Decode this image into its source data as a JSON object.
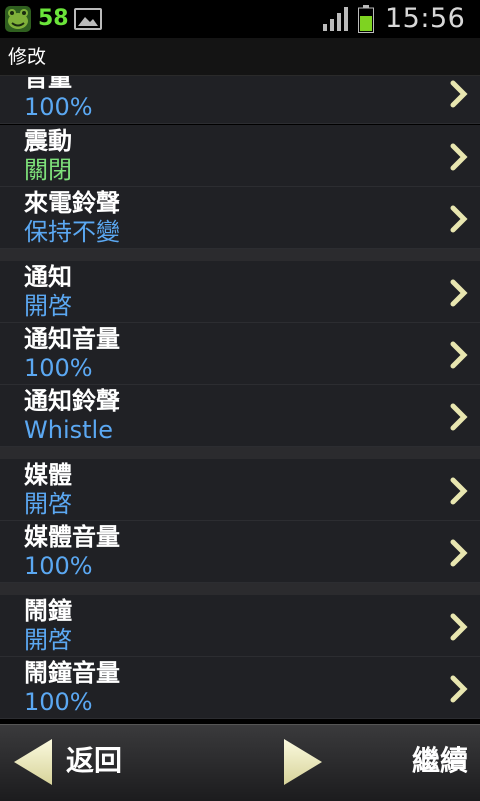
{
  "status_bar": {
    "app_icon": "frog-icon",
    "count": "58",
    "notification_icon": "image-icon",
    "signal_icon": "signal-bars-icon",
    "battery_icon": "battery-charging-icon",
    "time": "15:56"
  },
  "title": "修改",
  "items": [
    {
      "title": "音量",
      "value": "100%",
      "value_color": "#5ba8f2"
    },
    {
      "title": "震動",
      "value": "關閉",
      "value_color": "#7ee07a"
    },
    {
      "title": "來電鈴聲",
      "value": "保持不變",
      "value_color": "#5ba8f2"
    },
    {
      "title": "通知",
      "value": "開啓",
      "value_color": "#5ba8f2"
    },
    {
      "title": "通知音量",
      "value": "100%",
      "value_color": "#5ba8f2"
    },
    {
      "title": "通知鈴聲",
      "value": "Whistle",
      "value_color": "#5ba8f2"
    },
    {
      "title": "媒體",
      "value": "開啓",
      "value_color": "#5ba8f2"
    },
    {
      "title": "媒體音量",
      "value": "100%",
      "value_color": "#5ba8f2"
    },
    {
      "title": "鬧鐘",
      "value": "開啓",
      "value_color": "#5ba8f2"
    },
    {
      "title": "鬧鐘音量",
      "value": "100%",
      "value_color": "#5ba8f2"
    }
  ],
  "bottom_bar": {
    "back_label": "返回",
    "next_label": "繼續",
    "back_icon": "arrow-left-icon",
    "next_icon": "arrow-right-icon"
  },
  "colors": {
    "accent_value": "#5ba8f2",
    "off_value": "#7ee07a",
    "chevron": "#e8e6b0",
    "count_green": "#6be43a"
  }
}
